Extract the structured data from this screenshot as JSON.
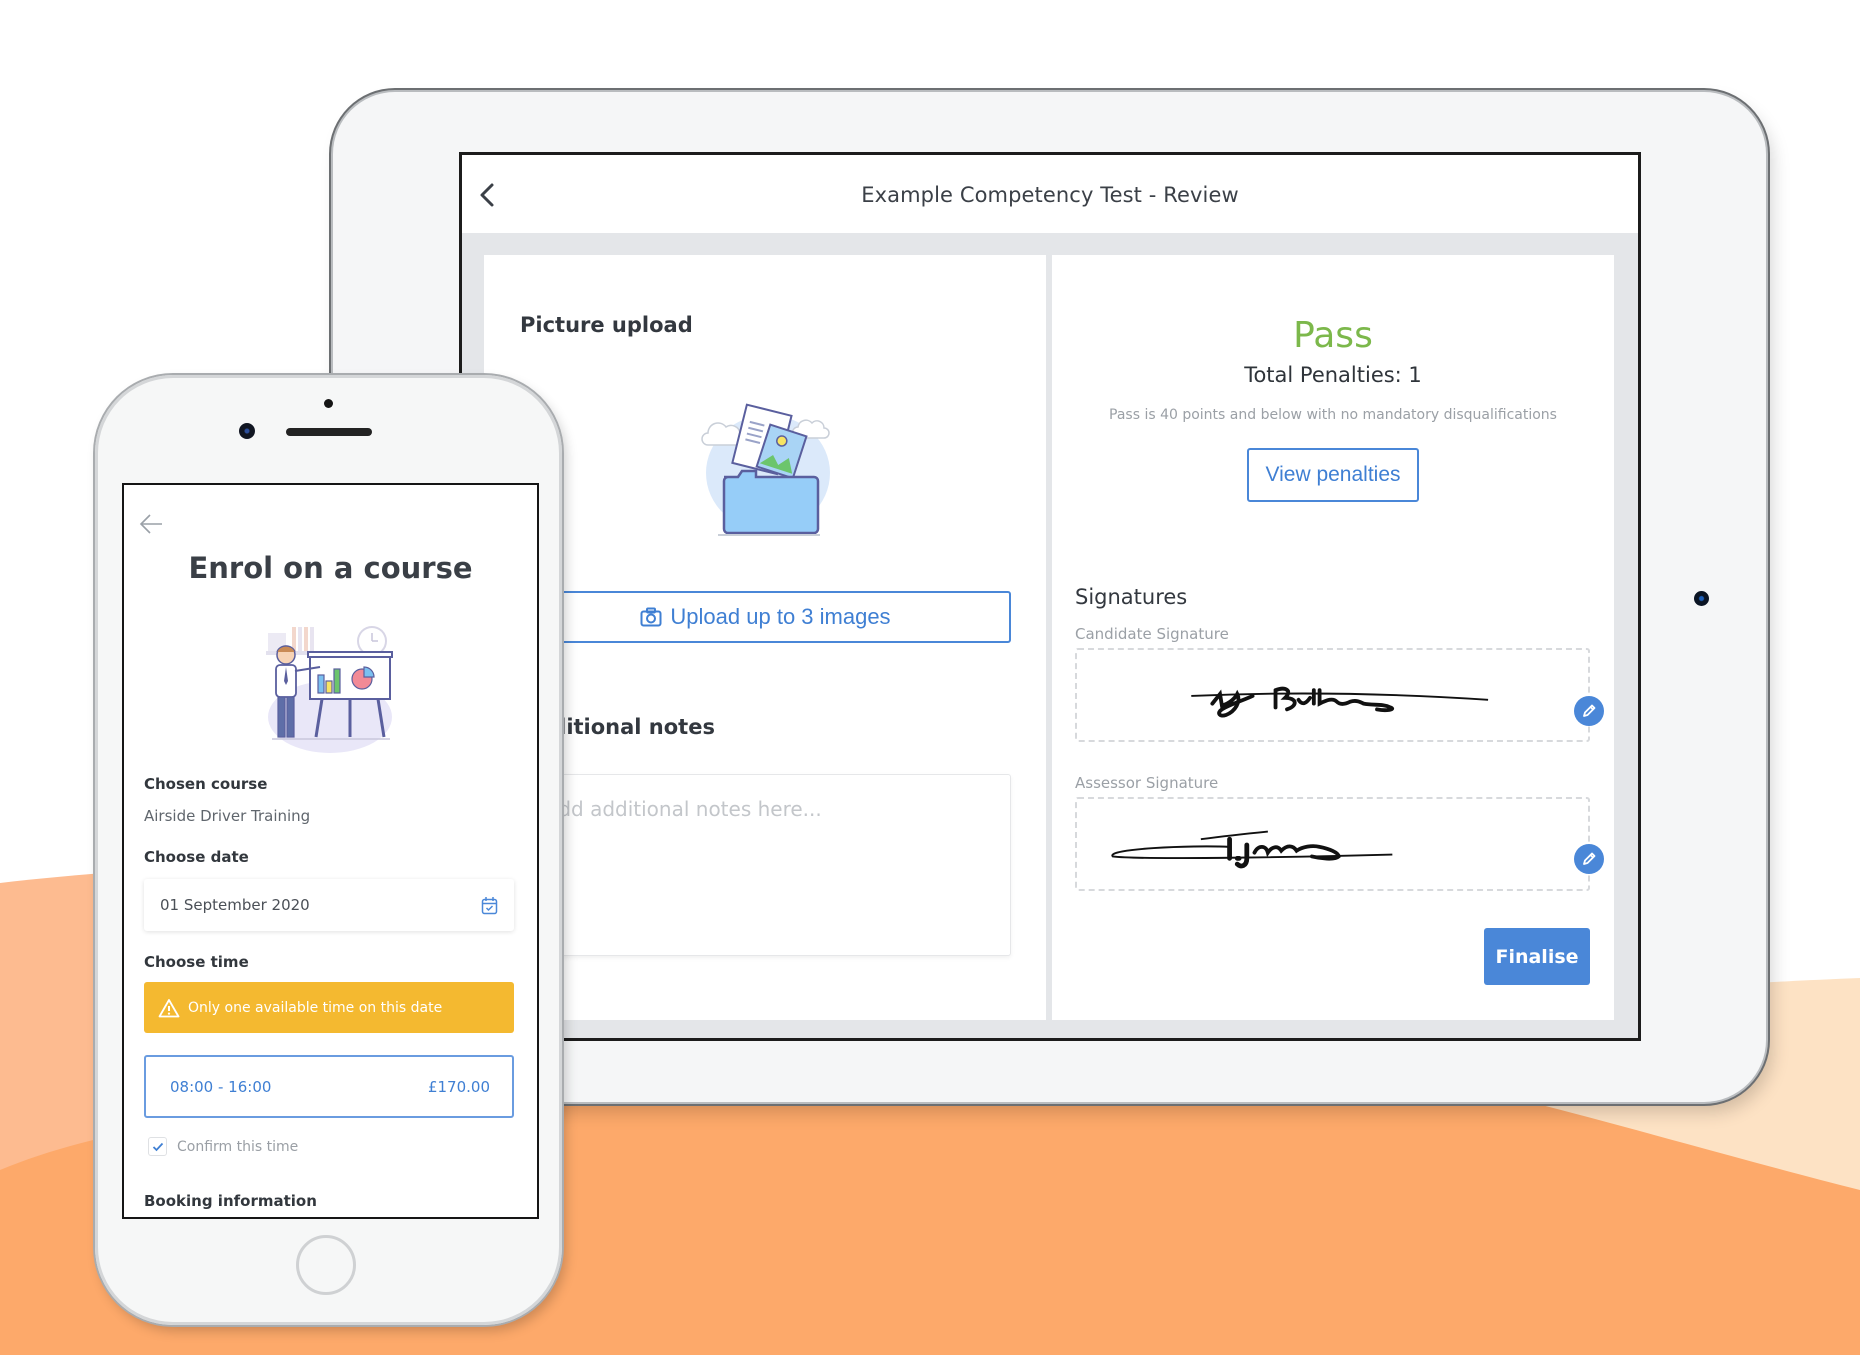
{
  "colors": {
    "accent_blue": "#4a87d8",
    "pass_green": "#7cb84b",
    "warning_yellow": "#f4b930",
    "orange_dark": "#fda96a",
    "orange_light": "#fdbb90",
    "peach": "#fde2c4"
  },
  "tablet": {
    "header": {
      "back_icon": "chevron-left-icon",
      "title": "Example Competency Test - Review"
    },
    "left_card": {
      "picture_upload_label": "Picture upload",
      "illustration": "folder-with-images-illustration",
      "upload_button": {
        "icon": "camera-icon",
        "label": "Upload up to 3 images"
      },
      "notes_label": "Additional notes",
      "notes_placeholder": "Add additional notes here...",
      "notes_value": ""
    },
    "right_card": {
      "result": "Pass",
      "total_penalties": "Total Penalties: 1",
      "pass_criteria": "Pass is 40 points and below with no mandatory disqualifications",
      "view_penalties_button": "View penalties",
      "signatures_label": "Signatures",
      "signatures": [
        {
          "label": "Candidate Signature",
          "edit_icon": "pencil-icon"
        },
        {
          "label": "Assessor Signature",
          "edit_icon": "pencil-icon"
        }
      ],
      "finalise_button": "Finalise"
    }
  },
  "phone": {
    "back_icon": "arrow-left-icon",
    "title": "Enrol on a course",
    "illustration": "presenter-with-chart-illustration",
    "chosen_course_label": "Chosen course",
    "chosen_course_value": "Airside Driver Training",
    "choose_date_label": "Choose date",
    "date_value": "01 September 2020",
    "date_icon": "calendar-check-icon",
    "choose_time_label": "Choose time",
    "alert": {
      "icon": "warning-triangle-icon",
      "text": "Only one available time on this date"
    },
    "time_slot": {
      "time": "08:00 - 16:00",
      "price": "£170.00"
    },
    "confirm_label": "Confirm this time",
    "confirm_checked": true,
    "booking_information_label": "Booking information"
  }
}
